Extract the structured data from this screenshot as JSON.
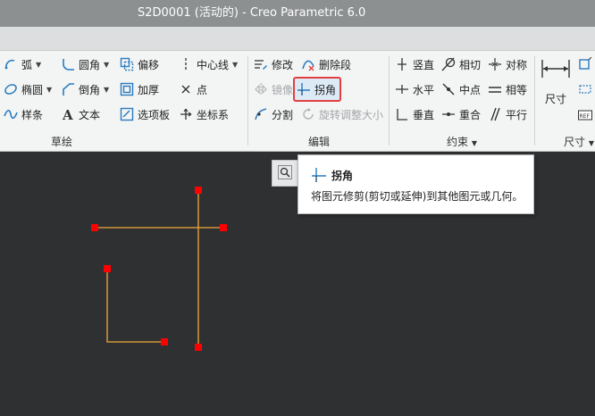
{
  "window": {
    "title": "S2D0001 (活动的) - Creo Parametric 6.0"
  },
  "ribbon": {
    "sketch_group": {
      "label": "草绘",
      "items": {
        "arc": "弧",
        "ellipse": "椭圆",
        "spline": "样条",
        "fillet": "圆角",
        "chamfer": "倒角",
        "text": "文本",
        "offset": "偏移",
        "thicken": "加厚",
        "palette": "选项板",
        "centerline": "中心线",
        "point": "点",
        "coord_sys": "坐标系"
      }
    },
    "edit_group": {
      "label": "编辑",
      "items": {
        "modify": "修改",
        "delete_segment": "删除段",
        "mirror": "镜像",
        "corner": "拐角",
        "divide": "分割",
        "rotate_resize": "旋转调整大小"
      }
    },
    "constrain_group": {
      "label": "约束",
      "items": {
        "vertical": "竖直",
        "tangent": "相切",
        "symmetric": "对称",
        "horizontal": "水平",
        "midpoint": "中点",
        "equal": "相等",
        "perpendicular": "垂直",
        "coincident": "重合",
        "parallel": "平行"
      }
    },
    "dimension_group": {
      "label": "尺寸",
      "dimension": "尺寸"
    }
  },
  "tooltip": {
    "title": "拐角",
    "description": "将图元修剪(剪切或延伸)到其他图元或几何。"
  },
  "colors": {
    "sketch_line": "#f2a83a",
    "vertex": "#ff0000",
    "highlight_border": "#e24040"
  }
}
